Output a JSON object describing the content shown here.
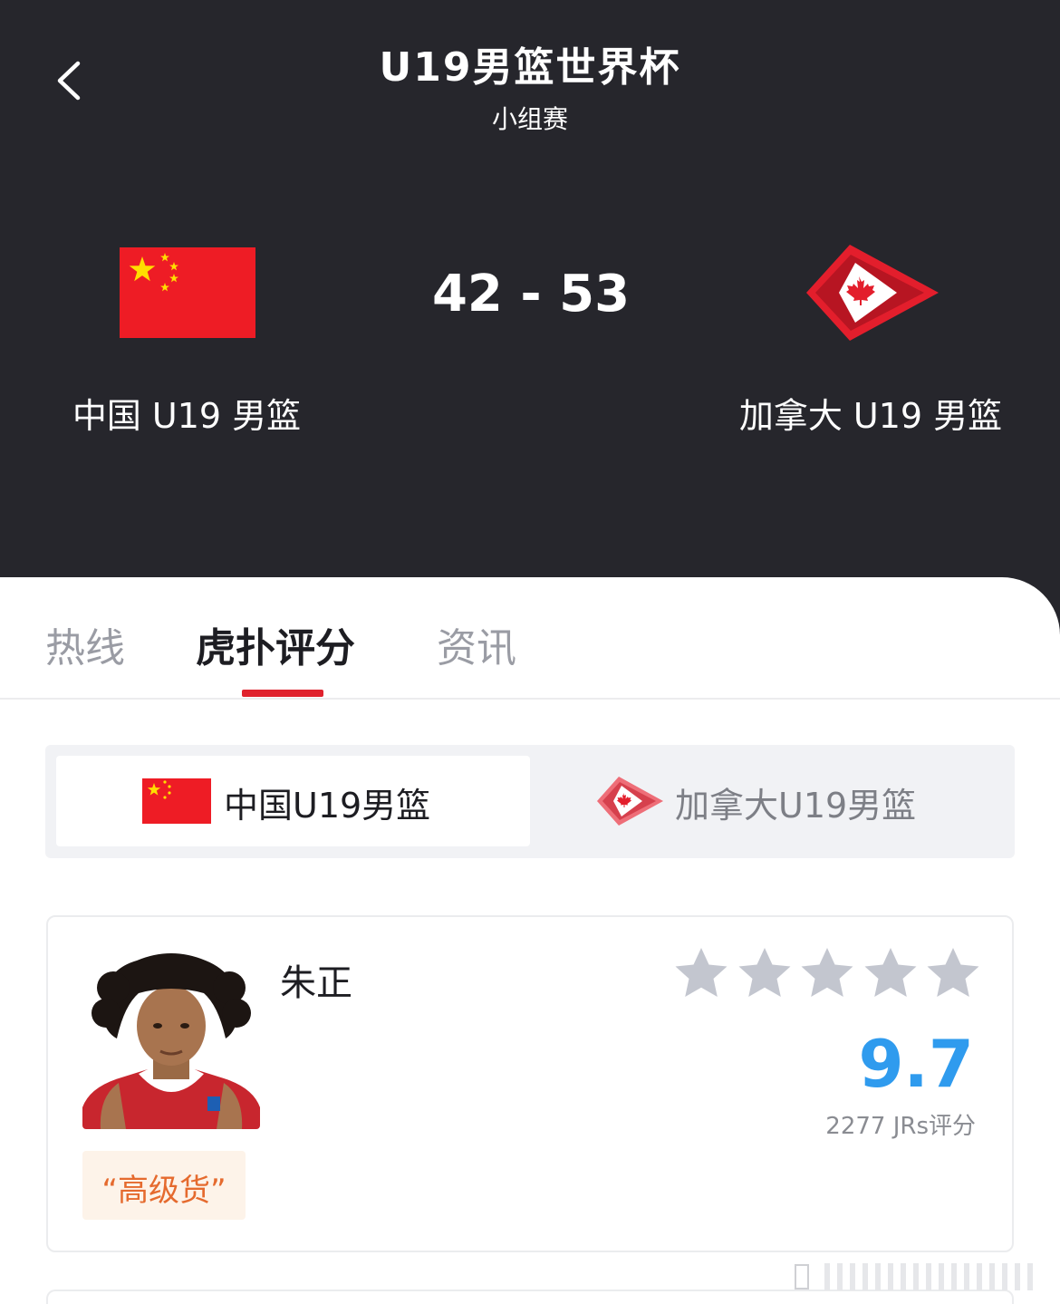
{
  "header": {
    "title": "U19男篮世界杯",
    "subtitle": "小组赛",
    "score": "42 - 53",
    "home_team": "中国 U19 男篮",
    "away_team": "加拿大 U19 男篮"
  },
  "tabs": [
    {
      "label": "热线"
    },
    {
      "label": "虎扑评分"
    },
    {
      "label": "资讯"
    }
  ],
  "team_switch": {
    "home_label": "中国U19男篮",
    "away_label": "加拿大U19男篮"
  },
  "player_card": {
    "name": "朱正",
    "rating": "9.7",
    "rating_count": "2277 JRs评分",
    "tag": "“高级货”"
  },
  "icons": {
    "back": "chevron-left-icon",
    "home_flag": "china-flag-icon",
    "away_flag": "canada-flag-icon",
    "star": "star-icon"
  },
  "colors": {
    "header_bg": "#26262c",
    "accent_red": "#e0222d",
    "rating_blue": "#2f9bee",
    "star_gray": "#c3c6cf",
    "tag_orange": "#e56a2e"
  }
}
